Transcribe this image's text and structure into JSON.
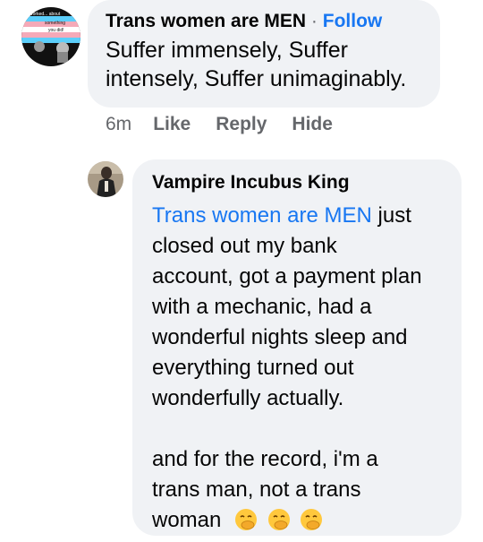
{
  "comment1": {
    "author": "Trans women are MEN",
    "separator": "·",
    "follow_label": "Follow",
    "text_line1": "Suffer immensely, Suffer",
    "text_line2": "intensely, Suffer unimaginably.",
    "time": "6m",
    "like_label": "Like",
    "reply_label": "Reply",
    "hide_label": "Hide",
    "avatar_caption_line1": "Worked... about",
    "avatar_caption_line2": "something",
    "avatar_caption_line3": "you did!",
    "avatar_colors": [
      "#5bcefa",
      "#f5a9b8",
      "#ffffff",
      "#f5a9b8",
      "#5bcefa"
    ]
  },
  "comment2": {
    "author": "Vampire Incubus King",
    "mention": "Trans women are MEN",
    "lines": [
      " just",
      "closed out my bank",
      "account, got a payment plan",
      "with a mechanic, had a",
      "wonderful nights sleep and",
      "everything turned out",
      "wonderfully actually."
    ],
    "lines2": [
      "and for the record, i'm a",
      "trans man, not a trans",
      "woman"
    ],
    "emojis": [
      "face-with-hand-over-mouth",
      "face-with-hand-over-mouth",
      "face-with-hand-over-mouth"
    ]
  },
  "colors": {
    "link_blue": "#1877f2",
    "bubble_gray": "#f0f2f5",
    "meta_gray": "#65676b",
    "emoji_yellow": "#ffc83d"
  }
}
